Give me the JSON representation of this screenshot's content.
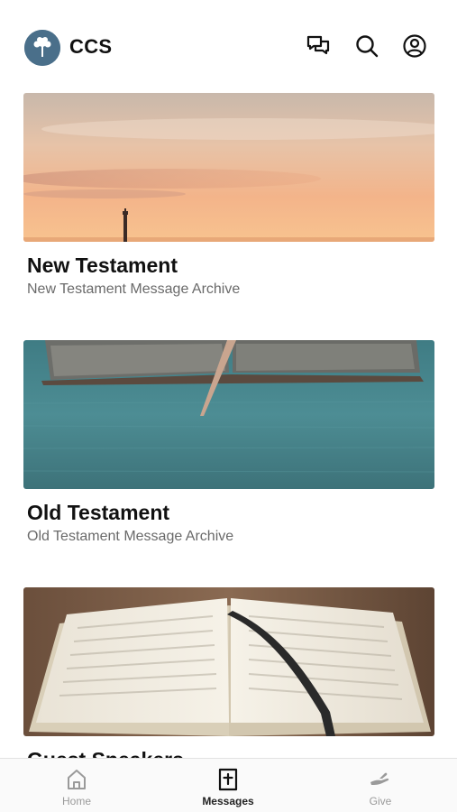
{
  "header": {
    "brand": "CCS",
    "icons": [
      "chat-icon",
      "search-icon",
      "profile-icon"
    ]
  },
  "cards": [
    {
      "title": "New Testament",
      "subtitle": "New Testament Message Archive",
      "image": "sunset-lighthouse"
    },
    {
      "title": "Old Testament",
      "subtitle": "Old Testament Message Archive",
      "image": "open-bible-teal-table"
    },
    {
      "title": "Guest Speakers",
      "subtitle": "",
      "image": "open-bible-ribbon"
    }
  ],
  "tabbar": {
    "tabs": [
      {
        "label": "Home",
        "icon": "home-icon",
        "active": false
      },
      {
        "label": "Messages",
        "icon": "bible-icon",
        "active": true
      },
      {
        "label": "Give",
        "icon": "give-icon",
        "active": false
      }
    ]
  },
  "colors": {
    "logo_bg": "#4a6f8a",
    "active_tab": "#222222",
    "inactive_tab": "#9a9a9a"
  }
}
